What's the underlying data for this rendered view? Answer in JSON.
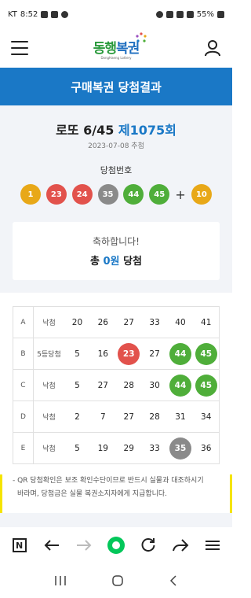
{
  "status_bar": {
    "carrier": "KT",
    "time": "8:52",
    "battery": "55%"
  },
  "header": {
    "logo_text_1": "동행",
    "logo_text_2": "복권",
    "logo_sub": "DongHaeng Lottery"
  },
  "title": "구매복권 당첨결과",
  "draw": {
    "game": "로또 6/45",
    "round": "제1075회",
    "date": "2023-07-08 추첨",
    "winning_label": "당첨번호",
    "numbers": [
      "1",
      "23",
      "24",
      "35",
      "44",
      "45"
    ],
    "plus": "+",
    "bonus": "10",
    "ball_colors": [
      "#e8a818",
      "#e2524c",
      "#e2524c",
      "#8a8a8a",
      "#4fae3a",
      "#4fae3a",
      "#e8a818"
    ]
  },
  "result": {
    "congrats": "축하합니다!",
    "total_prefix": "총",
    "prize": "0원",
    "total_suffix": "당첨"
  },
  "tickets": [
    {
      "label": "A",
      "result": "낙첨",
      "numbers": [
        "20",
        "26",
        "27",
        "33",
        "40",
        "41"
      ],
      "hits": [
        false,
        false,
        false,
        false,
        false,
        false
      ]
    },
    {
      "label": "B",
      "result": "5등당첨",
      "numbers": [
        "5",
        "16",
        "23",
        "27",
        "44",
        "45"
      ],
      "hits": [
        false,
        false,
        true,
        false,
        true,
        true
      ]
    },
    {
      "label": "C",
      "result": "낙첨",
      "numbers": [
        "5",
        "27",
        "28",
        "30",
        "44",
        "45"
      ],
      "hits": [
        false,
        false,
        false,
        false,
        true,
        true
      ]
    },
    {
      "label": "D",
      "result": "낙첨",
      "numbers": [
        "2",
        "7",
        "27",
        "28",
        "31",
        "34"
      ],
      "hits": [
        false,
        false,
        false,
        false,
        false,
        false
      ]
    },
    {
      "label": "E",
      "result": "낙첨",
      "numbers": [
        "5",
        "19",
        "29",
        "33",
        "35",
        "36"
      ],
      "hits": [
        false,
        false,
        false,
        false,
        true,
        false
      ]
    }
  ],
  "hit_colors": {
    "23": "#e2524c",
    "35": "#8a8a8a",
    "44": "#4fae3a",
    "45": "#4fae3a"
  },
  "note_line_1": "- QR 당첨확인은 보조 확인수단이므로 반드시 실물과 대조하시기",
  "note_line_2": "바라며, 당첨금은 실물 복권소지자에게 지급합니다.",
  "toolbar": {
    "n_label": "N"
  },
  "colors": {
    "accent": "#1a78c6",
    "naver_green": "#03c75a"
  }
}
